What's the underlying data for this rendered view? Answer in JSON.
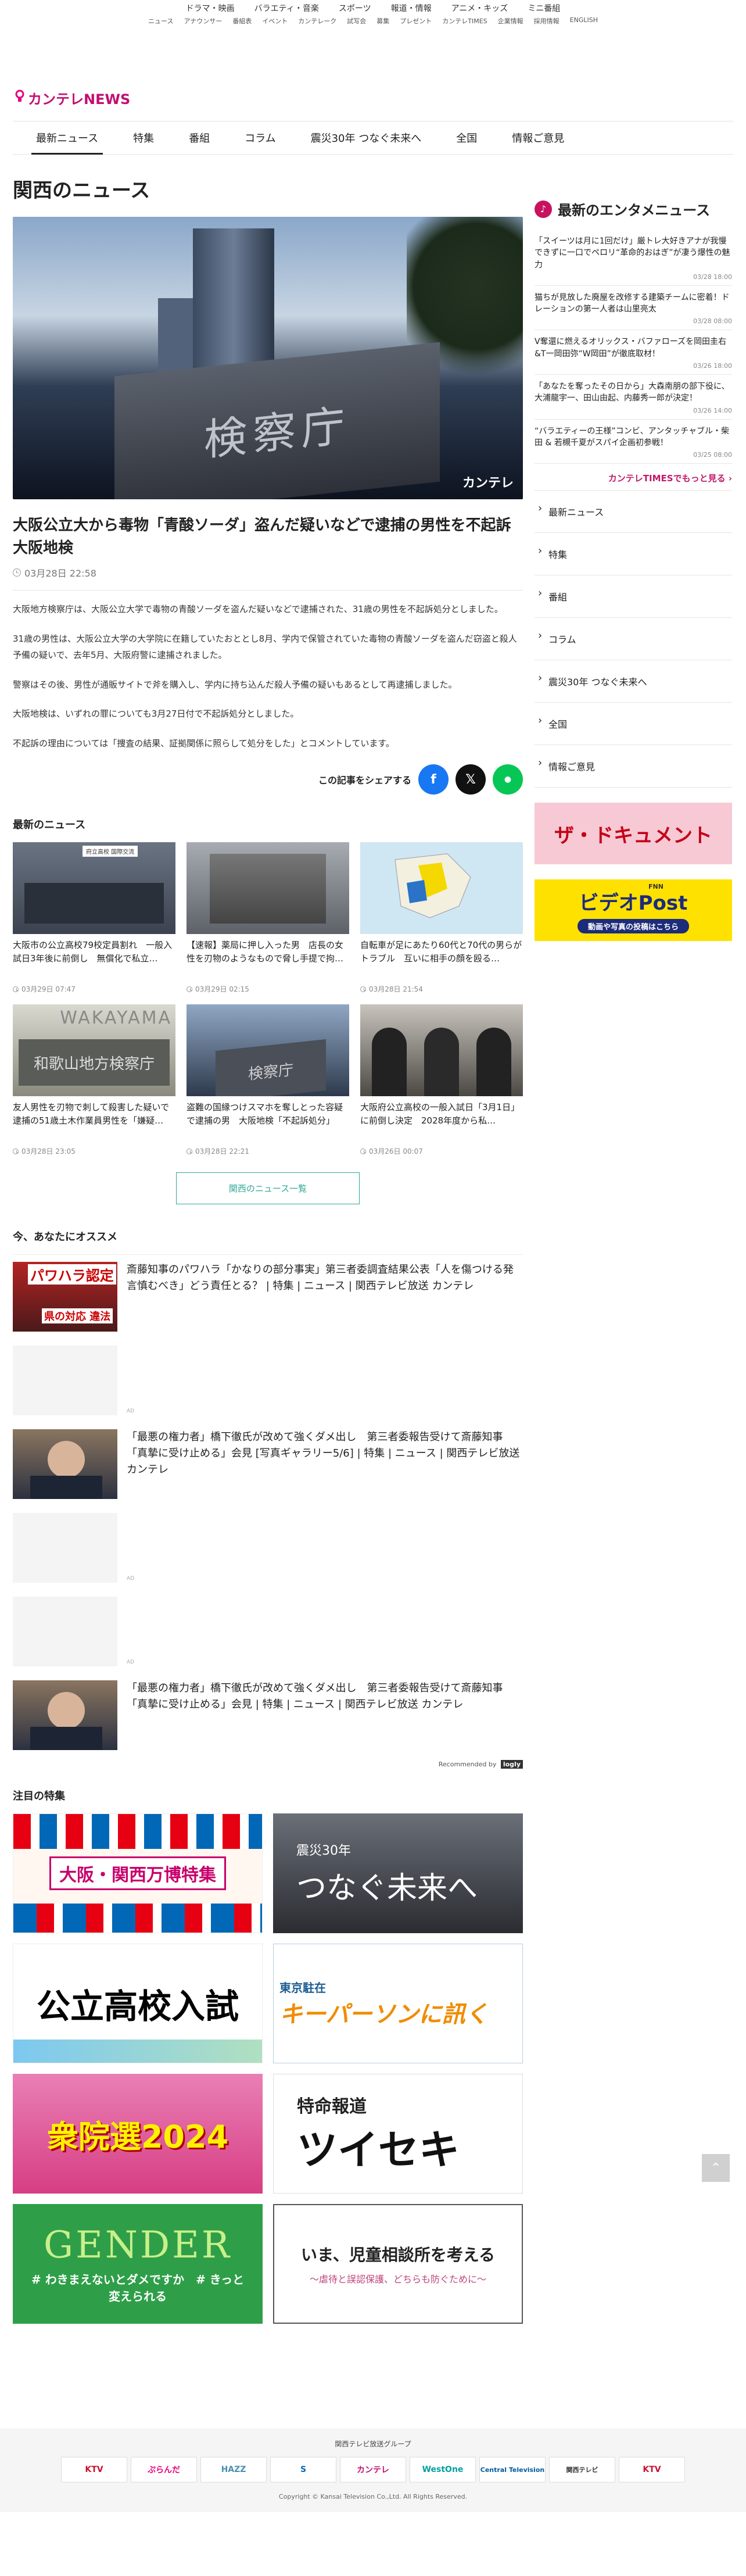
{
  "topnav": {
    "row1": [
      "ドラマ・映画",
      "バラエティ・音楽",
      "スポーツ",
      "報道・情報",
      "アニメ・キッズ",
      "ミニ番組"
    ],
    "row2": [
      "ニュース",
      "アナウンサー",
      "番組表",
      "イベント",
      "カンテレーク",
      "試写会",
      "募集",
      "プレゼント",
      "カンテレTIMES",
      "企業情報",
      "採用情報",
      "ENGLISH"
    ]
  },
  "brand": {
    "logo": "カンテレNEWS"
  },
  "mainnav": [
    "最新ニュース",
    "特集",
    "番組",
    "コラム",
    "震災30年 つなぐ未来へ",
    "全国",
    "情報ご意見"
  ],
  "page_title": "関西のニュース",
  "hero": {
    "sign": "検察庁",
    "watermark": "カンテレ"
  },
  "article": {
    "title": "大阪公立大から毒物「青酸ソーダ」盗んだ疑いなどで逮捕の男性を不起訴　大阪地検",
    "date": "03月28日 22:58",
    "paras": [
      "大阪地方検察庁は、大阪公立大学で毒物の青酸ソーダを盗んだ疑いなどで逮捕された、31歳の男性を不起訴処分としました。",
      "31歳の男性は、大阪公立大学の大学院に在籍していたおととし8月、学内で保管されていた毒物の青酸ソーダを盗んだ窃盗と殺人予備の疑いで、去年5月、大阪府警に逮捕されました。",
      "警察はその後、男性が通販サイトで斧を購入し、学内に持ち込んだ殺人予備の疑いもあるとして再逮捕しました。",
      "大阪地検は、いずれの罪についても3月27日付で不起訴処分としました。",
      "不起訴の理由については「捜査の結果、証拠関係に照らして処分をした」とコメントしています。"
    ],
    "share_label": "この記事をシェアする"
  },
  "latest": {
    "heading": "最新のニュース",
    "items": [
      {
        "caption": "大阪市の公立高校79校定員割れ　一般入試日3年後に前倒し　無償化で私立…",
        "date": "03月29日 07:47"
      },
      {
        "caption": "【速報】薬局に押し入った男　店長の女性を刃物のようなもので脅し手提で拘…",
        "date": "03月29日 02:15"
      },
      {
        "caption": "自転車が足にあたり60代と70代の男らがトラブル　互いに相手の顔を殴る…",
        "date": "03月28日 21:54"
      },
      {
        "caption": "友人男性を刃物で刺して殺害した疑いで逮捕の51歳土木作業員男性を「嫌疑…",
        "date": "03月28日 23:05"
      },
      {
        "caption": "盗難の国縁つけスマホを奪しとった容疑で逮捕の男　大阪地検「不起訴処分」",
        "date": "03月28日 22:21"
      },
      {
        "caption": "大阪府公立高校の一般入試日「3月1日」に前倒し決定　2028年度から私…",
        "date": "03月26日 00:07"
      }
    ],
    "thumb_texts": {
      "t1": "府立高校 国際交流",
      "t4": "和歌山地方検察庁",
      "t4b": "WAKAYAMA",
      "t5": "検察庁"
    },
    "more_label": "関西のニュース一覧"
  },
  "recommend": {
    "heading": "今、あなたにオススメ",
    "items": [
      {
        "type": "article",
        "text": "斎藤知事のパワハラ「かなりの部分事実」第三者委調査結果公表「人を傷つける発言慎むべき」どう責任とる？ | 特集 | ニュース | 関西テレビ放送 カンテレ",
        "thumb1": "パワハラ認定",
        "thumb2": "県の対応 違法"
      },
      {
        "type": "ad"
      },
      {
        "type": "article",
        "text": "「最悪の権力者」橋下徹氏が改めて強くダメ出し　第三者委報告受けて斎藤知事「真摯に受け止める」会見 [写真ギャラリー5/6] | 特集 | ニュース | 関西テレビ放送 カンテレ"
      },
      {
        "type": "ad"
      },
      {
        "type": "ad"
      },
      {
        "type": "article",
        "text": "「最悪の権力者」橋下徹氏が改めて強くダメ出し　第三者委報告受けて斎藤知事「真摯に受け止める」会見 | 特集 | ニュース | 関西テレビ放送 カンテレ"
      }
    ],
    "ad_label": "AD",
    "recommended_by": "Recommended by",
    "recommended_logo": "logly"
  },
  "features": {
    "heading": "注目の特集",
    "items": [
      {
        "text": "大阪・関西万博特集"
      },
      {
        "text": "つなぐ未来へ",
        "sub": "震災30年"
      },
      {
        "text": "公立高校入試"
      },
      {
        "text": "キーパーソンに訊く",
        "sub": "東京駐在"
      },
      {
        "text": "衆院選2024"
      },
      {
        "text": "ツイセキ",
        "sub": "特命報道"
      },
      {
        "text": "GENDER",
        "sub": "# わきまえないとダメですか　# きっと変えられる"
      },
      {
        "text": "いま、児童相談所を考える",
        "sub": "〜虐待と誤認保護、どちらも防ぐために〜"
      }
    ]
  },
  "sidebar": {
    "heading": "最新のエンタメニュース",
    "news": [
      {
        "t": "「スイーツは月に1回だけ」厳トレ大好きアナが我慢できずに一口でペロリ“革命的おはぎ”が凄う爆性の魅力",
        "d": "03/28 18:00"
      },
      {
        "t": "猫ちが見放した廃屋を改修する建築チームに密着！ドレーションの第一人者は山里亮太",
        "d": "03/28 08:00"
      },
      {
        "t": "V奪還に燃えるオリックス・バファローズを岡田圭右&T一岡田弥“W岡田”が徹底取材！",
        "d": "03/26 18:00"
      },
      {
        "t": "「あなたを奪ったその日から」大森南朋の部下役に、大浦龍宇一、田山由起、内藤秀一郎が決定！",
        "d": "03/26 14:00"
      },
      {
        "t": "“バラエティーの王様”コンビ、アンタッチャブル・柴田 & 若槻千夏がスパイ企画初参戦！",
        "d": "03/25 08:00"
      }
    ],
    "more": "カンテレTIMESでもっと見る",
    "links": [
      "最新ニュース",
      "特集",
      "番組",
      "コラム",
      "震災30年 つなぐ未来へ",
      "全国",
      "情報ご意見"
    ],
    "banner1": "ザ・ドキュメント",
    "banner2": "ビデオPost",
    "banner2_sub": "動画や写真の投稿はこちら",
    "banner2_tag": "FNN"
  },
  "footer": {
    "group": "関西テレビ放送グループ",
    "logos": [
      "KTV",
      "ぷらんだ",
      "HAZZ",
      "S",
      "カンテレ",
      "WestOne",
      "Central Television",
      "関西テレビ",
      "KTV"
    ],
    "copyright": "Copyright © Kansai Television Co.,Ltd. All Rights Reserved."
  },
  "colors": {
    "brand": "#c20f73",
    "facebook": "#1877f2",
    "x": "#111111",
    "line": "#06c755",
    "teal": "#2fa896"
  }
}
